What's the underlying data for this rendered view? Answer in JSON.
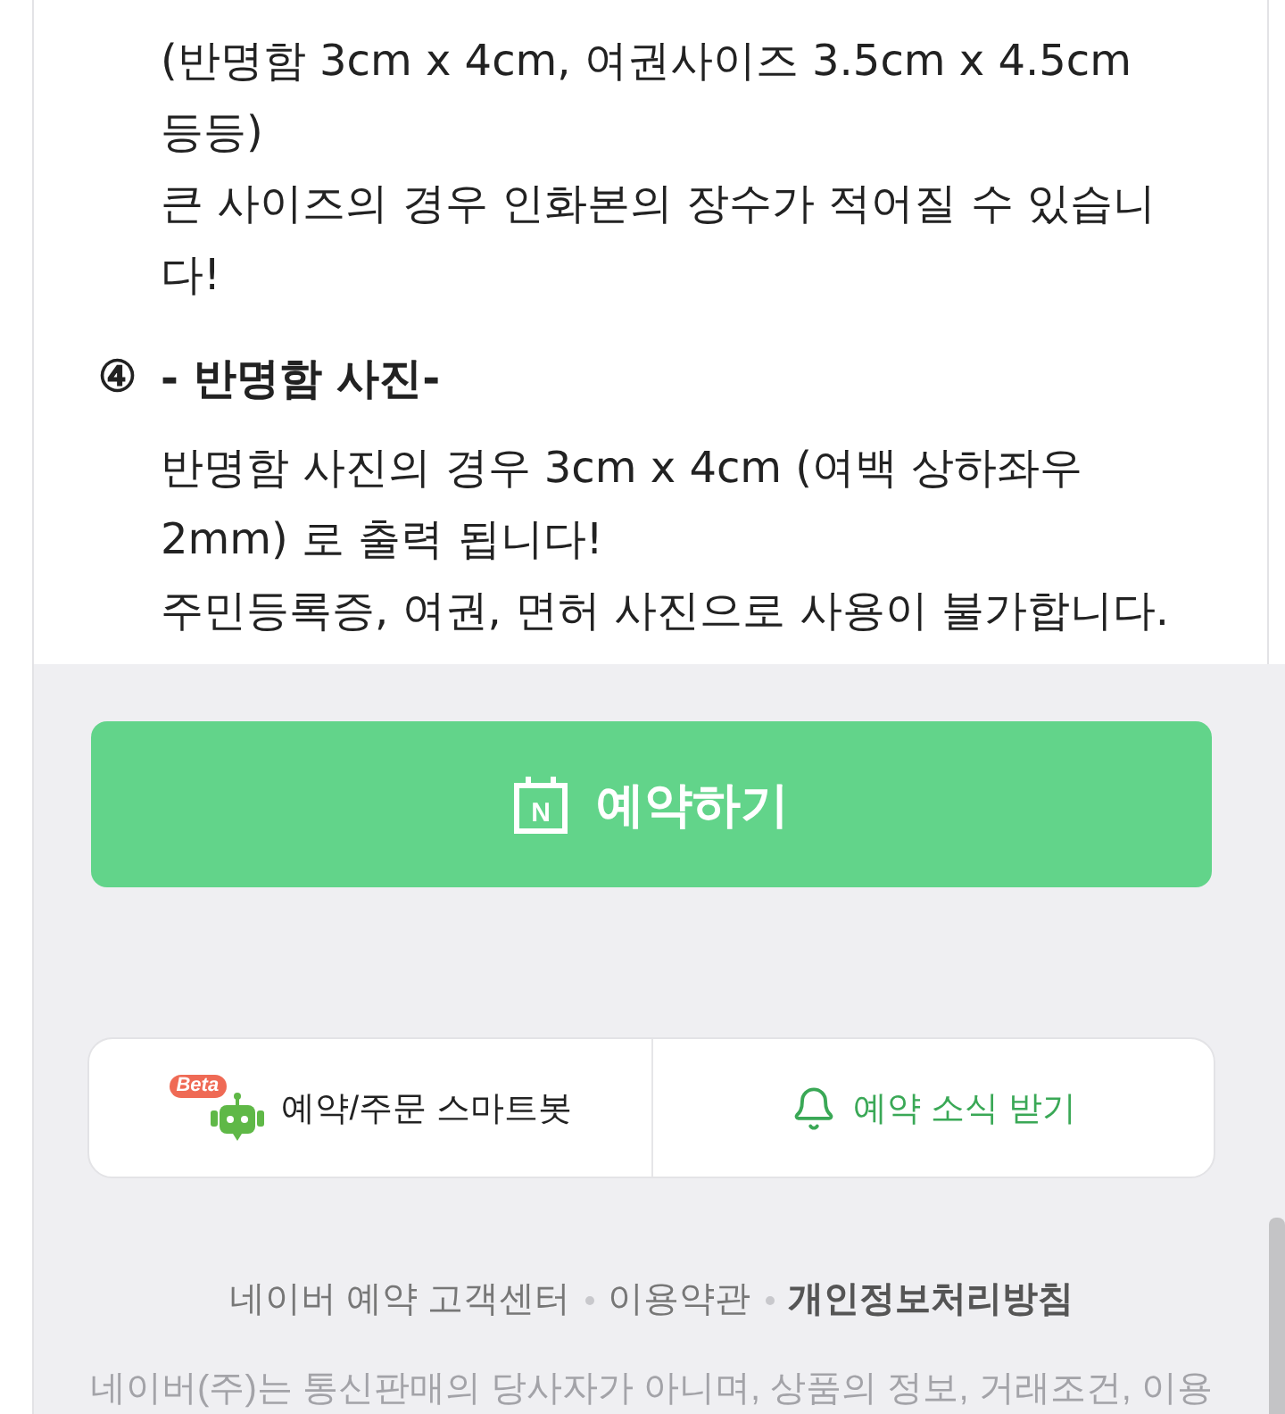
{
  "notice_sections": [
    {
      "lines": [
        "(반명함 3cm x 4cm, 여권사이즈 3.5cm x 4.5cm 등등)",
        "큰 사이즈의 경우 인화본의 장수가 적어질 수 있습니다!"
      ]
    },
    {
      "number": "④",
      "title": "- 반명함 사진-",
      "lines": [
        "반명함 사진의 경우 3cm x 4cm (여백 상하좌우 2mm) 로 출력 됩니다!",
        "주민등록증, 여권, 면허 사진으로 사용이 불가합니다."
      ]
    }
  ],
  "reserve_button": {
    "icon_letter": "N",
    "label": "예약하기"
  },
  "action_card": {
    "items": [
      {
        "kind": "smartbot",
        "badge": "Beta",
        "label": "예약/주문 스마트봇"
      },
      {
        "kind": "alert",
        "label": "예약 소식 받기"
      }
    ]
  },
  "footer": {
    "links": [
      {
        "label": "네이버 예약 고객센터",
        "emphasized": false
      },
      {
        "label": "이용약관",
        "emphasized": false
      },
      {
        "label": "개인정보처리방침",
        "emphasized": true
      }
    ],
    "disclaimer": "네이버(주)는 통신판매의 당사자가 아니며, 상품의 정보, 거래조건, 이용"
  }
}
